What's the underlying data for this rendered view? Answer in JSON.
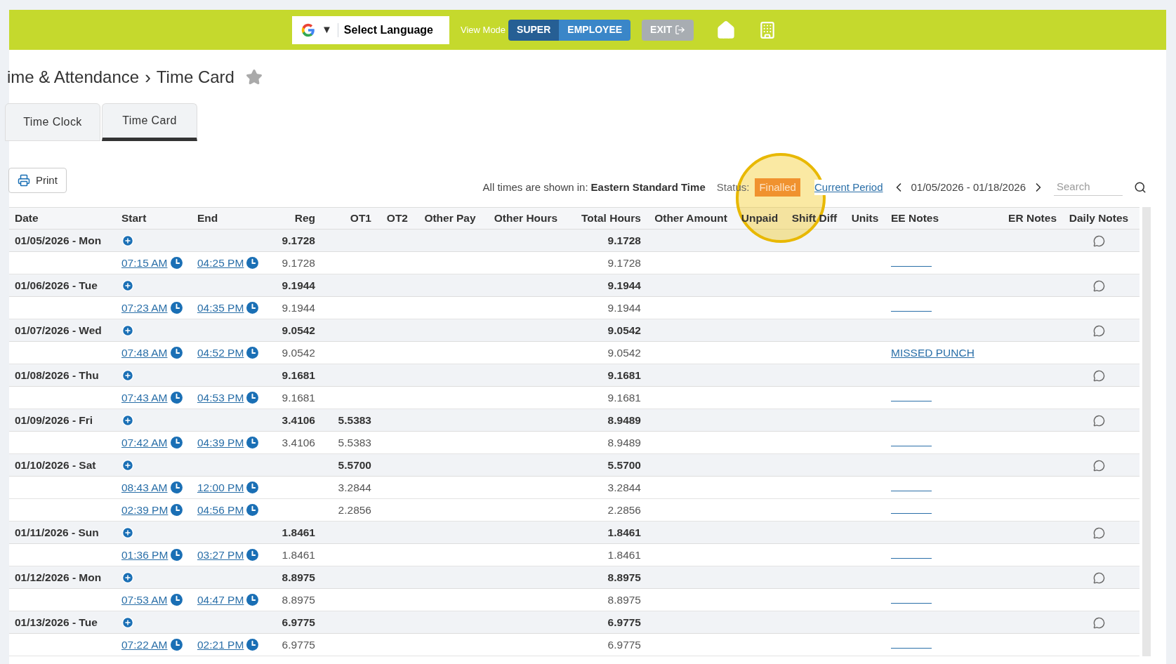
{
  "top_bar": {
    "language_selector": {
      "label": "Select Language",
      "caret": "▼"
    },
    "view_mode": {
      "label": "View Mode",
      "options": [
        {
          "label": "SUPER",
          "selected": true
        },
        {
          "label": "EMPLOYEE",
          "selected": false
        }
      ]
    },
    "exit_button": "EXIT"
  },
  "breadcrumb": {
    "parent": "ime & Attendance",
    "separator": "›",
    "current": "Time Card"
  },
  "tabs": [
    {
      "label": "Time Clock",
      "selected": false
    },
    {
      "label": "Time Card",
      "selected": true
    }
  ],
  "toolbar": {
    "print": "Print",
    "timezone_label": "All times are shown in:",
    "timezone": "Eastern Standard Time",
    "status_label": "Status:",
    "status": "Finalled",
    "period_link": "Current Period",
    "date_range": "01/05/2026 - 01/18/2026",
    "search_placeholder": "Search"
  },
  "table": {
    "columns": [
      "Date",
      "Start",
      "End",
      "Reg",
      "OT1",
      "OT2",
      "Other Pay",
      "Other Hours",
      "Total Hours",
      "Other Amount",
      "Unpaid",
      "Shift Diff",
      "Units",
      "EE Notes",
      "ER Notes",
      "Daily Notes"
    ],
    "days": [
      {
        "date": "01/05/2026 - Mon",
        "reg": "9.1728",
        "total": "9.1728",
        "punches": [
          {
            "start": "07:15 AM",
            "end": "04:25 PM",
            "reg": "9.1728",
            "total": "9.1728"
          }
        ]
      },
      {
        "date": "01/06/2026 - Tue",
        "reg": "9.1944",
        "total": "9.1944",
        "punches": [
          {
            "start": "07:23 AM",
            "end": "04:35 PM",
            "reg": "9.1944",
            "total": "9.1944"
          }
        ]
      },
      {
        "date": "01/07/2026 - Wed",
        "reg": "9.0542",
        "total": "9.0542",
        "punches": [
          {
            "start": "07:48 AM",
            "end": "04:52 PM",
            "reg": "9.0542",
            "total": "9.0542",
            "ee_note": "MISSED PUNCH"
          }
        ]
      },
      {
        "date": "01/08/2026 - Thu",
        "reg": "9.1681",
        "total": "9.1681",
        "punches": [
          {
            "start": "07:43 AM",
            "end": "04:53 PM",
            "reg": "9.1681",
            "total": "9.1681"
          }
        ]
      },
      {
        "date": "01/09/2026 - Fri",
        "reg": "3.4106",
        "ot1": "5.5383",
        "total": "8.9489",
        "punches": [
          {
            "start": "07:42 AM",
            "end": "04:39 PM",
            "reg": "3.4106",
            "ot1": "5.5383",
            "total": "8.9489"
          }
        ]
      },
      {
        "date": "01/10/2026 - Sat",
        "ot1": "5.5700",
        "total": "5.5700",
        "punches": [
          {
            "start": "08:43 AM",
            "end": "12:00 PM",
            "ot1": "3.2844",
            "total": "3.2844"
          },
          {
            "start": "02:39 PM",
            "end": "04:56 PM",
            "ot1": "2.2856",
            "total": "2.2856"
          }
        ]
      },
      {
        "date": "01/11/2026 - Sun",
        "reg": "1.8461",
        "total": "1.8461",
        "punches": [
          {
            "start": "01:36 PM",
            "end": "03:27 PM",
            "reg": "1.8461",
            "total": "1.8461"
          }
        ]
      },
      {
        "date": "01/12/2026 - Mon",
        "reg": "8.8975",
        "total": "8.8975",
        "punches": [
          {
            "start": "07:53 AM",
            "end": "04:47 PM",
            "reg": "8.8975",
            "total": "8.8975"
          }
        ]
      },
      {
        "date": "01/13/2026 - Tue",
        "reg": "6.9775",
        "total": "6.9775",
        "punches": [
          {
            "start": "07:22 AM",
            "end": "02:21 PM",
            "reg": "6.9775",
            "total": "6.9775"
          }
        ]
      }
    ]
  }
}
